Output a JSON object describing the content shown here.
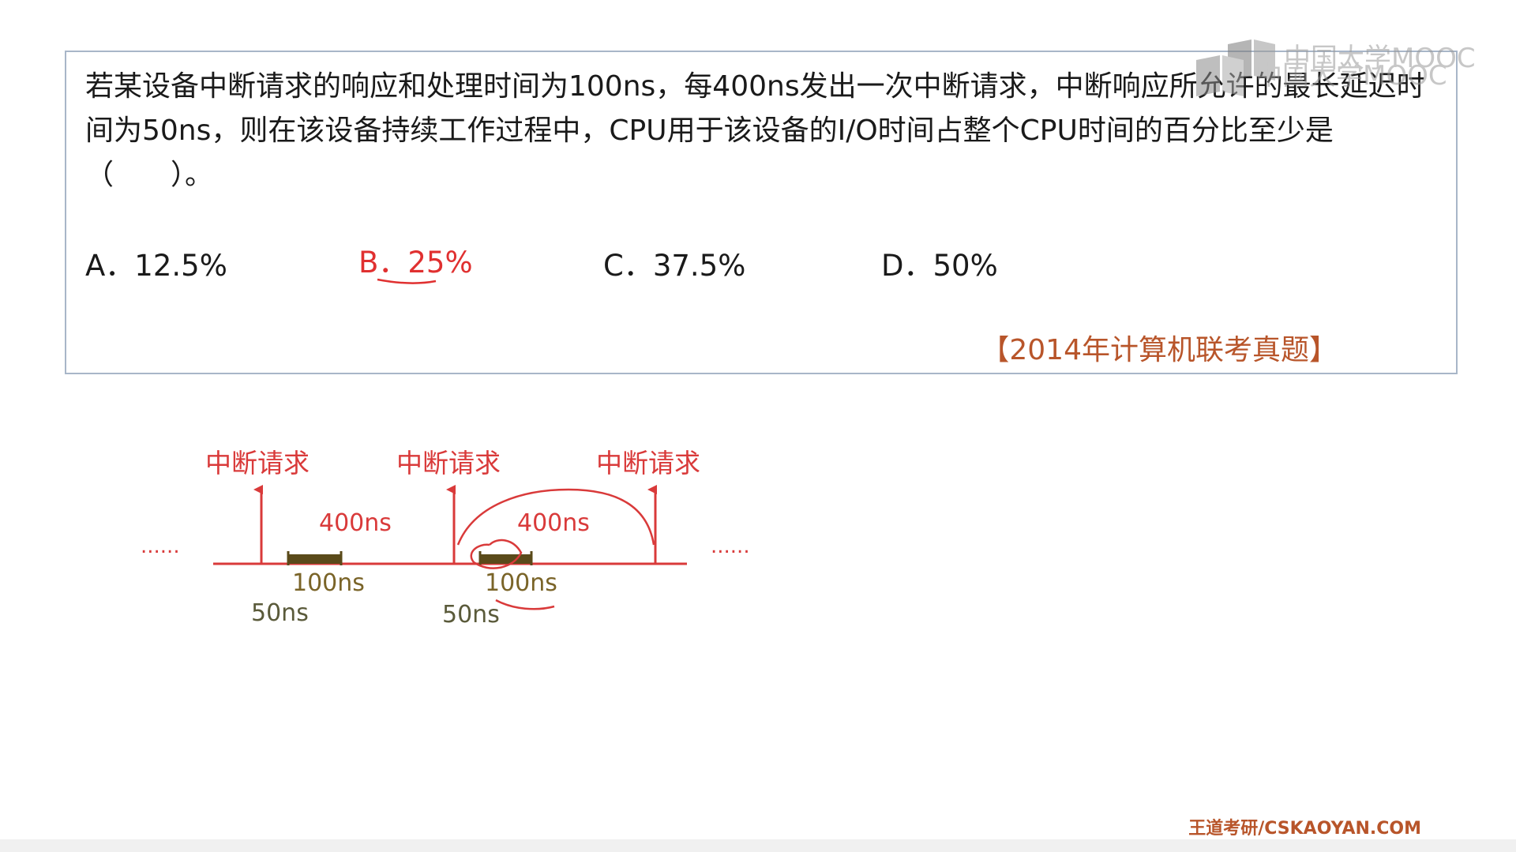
{
  "question": {
    "lines": [
      "若某设备中断请求的响应和处理时间为100ns，每400ns发出一次中断请求，中断响应所允许的最长延迟时",
      "间为50ns，则在该设备持续工作过程中，CPU用于该设备的I/O时间占整个CPU时间的百分比至少是",
      "（　　）。"
    ],
    "options": {
      "a": "A．12.5%",
      "b": "B．25%",
      "c": "C．37.5%",
      "d": "D．50%"
    },
    "selected_option": "b",
    "source": "【2014年计算机联考真题】"
  },
  "diagram": {
    "request_label": "中断请求",
    "period_label": "400ns",
    "service_label": "100ns",
    "latency_label": "50ns",
    "ellipsis": "......"
  },
  "watermark": {
    "text": "中国大学MOOC"
  },
  "footer": {
    "credit": "王道考研/CSKAOYAN.COM"
  },
  "colors": {
    "accent_red": "#e03030",
    "timeline_red": "#d93a3a",
    "bar_olive": "#5a4a1a",
    "label_olive": "#7a6428",
    "source_orange": "#b8552a"
  }
}
